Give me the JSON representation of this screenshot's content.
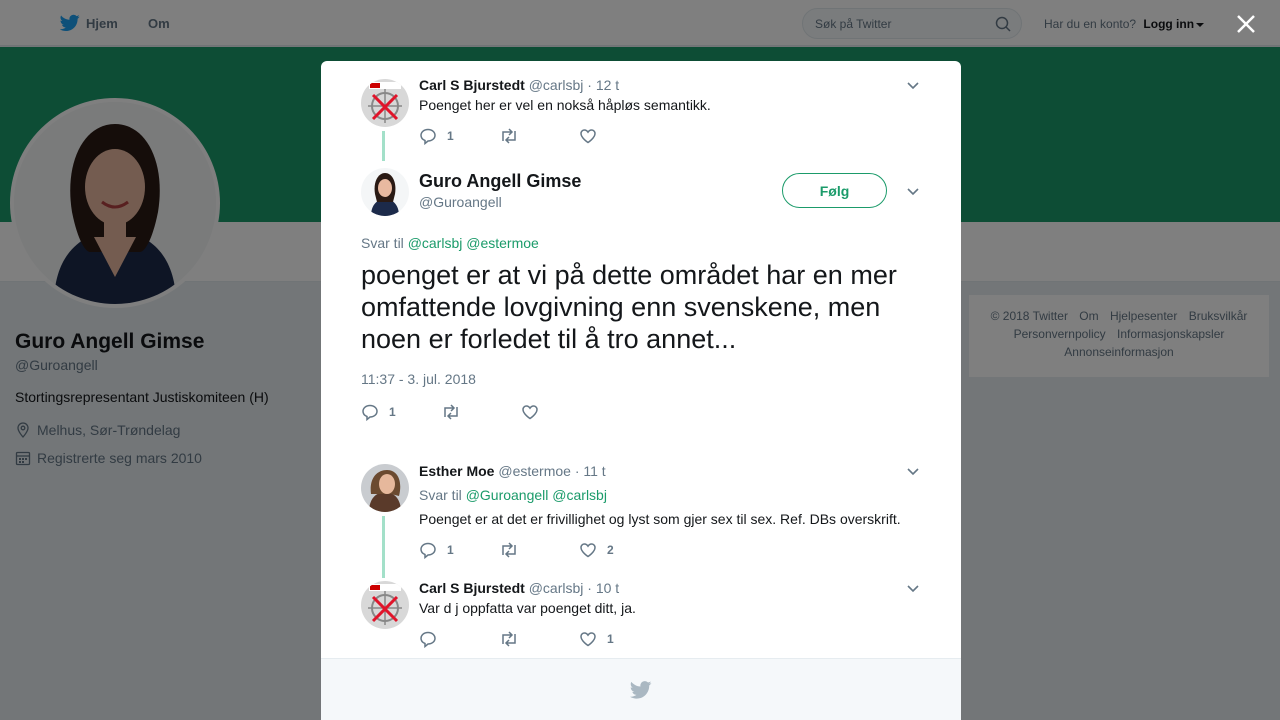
{
  "topbar": {
    "home_label": "Hjem",
    "about_label": "Om",
    "search_placeholder": "Søk på Twitter",
    "account_question": "Har du en konto?",
    "login_label": "Logg inn"
  },
  "profile": {
    "name": "Guro Angell Gimse",
    "handle": "@Guroangell",
    "bio": "Stortingsrepresentant Justiskomiteen (H)",
    "location": "Melhus, Sør-Trøndelag",
    "joined": "Registrerte seg mars 2010"
  },
  "footer": {
    "items": [
      "© 2018 Twitter",
      "Om",
      "Hjelpesenter",
      "Bruksvilkår",
      "Personvernpolicy",
      "Informasjonskapsler",
      "Annonseinformasjon"
    ]
  },
  "modal": {
    "tweet1": {
      "name": "Carl S Bjurstedt",
      "handle": "@carlsbj",
      "time": "· 12 t",
      "text": "Poenget her er vel en nokså håpløs semantikk.",
      "replies": "1"
    },
    "main": {
      "name": "Guro Angell Gimse",
      "handle": "@Guroangell",
      "follow_label": "Følg",
      "reply_prefix": "Svar til",
      "reply_mentions": "@carlsbj @estermoe",
      "text": "poenget er at vi på dette området har en mer omfattende lovgivning enn svenskene, men noen er forledet til å tro annet...",
      "timestamp": "11:37 - 3. jul. 2018",
      "replies": "1"
    },
    "tweet3": {
      "name": "Esther Moe",
      "handle": "@estermoe",
      "time": "· 11 t",
      "reply_prefix": "Svar til",
      "reply_mentions": "@Guroangell @carlsbj",
      "text": "Poenget er at det er frivillighet og lyst som gjer sex til sex. Ref. DBs overskrift.",
      "replies": "1",
      "likes": "2"
    },
    "tweet4": {
      "name": "Carl S Bjurstedt",
      "handle": "@carlsbj",
      "time": "· 10 t",
      "text": "Var d j oppfatta var poenget ditt, ja.",
      "likes": "1"
    }
  },
  "colors": {
    "accent": "#1b9b6a",
    "thread_line": "#a3e0c9",
    "twitter_blue": "#1da1f2"
  }
}
